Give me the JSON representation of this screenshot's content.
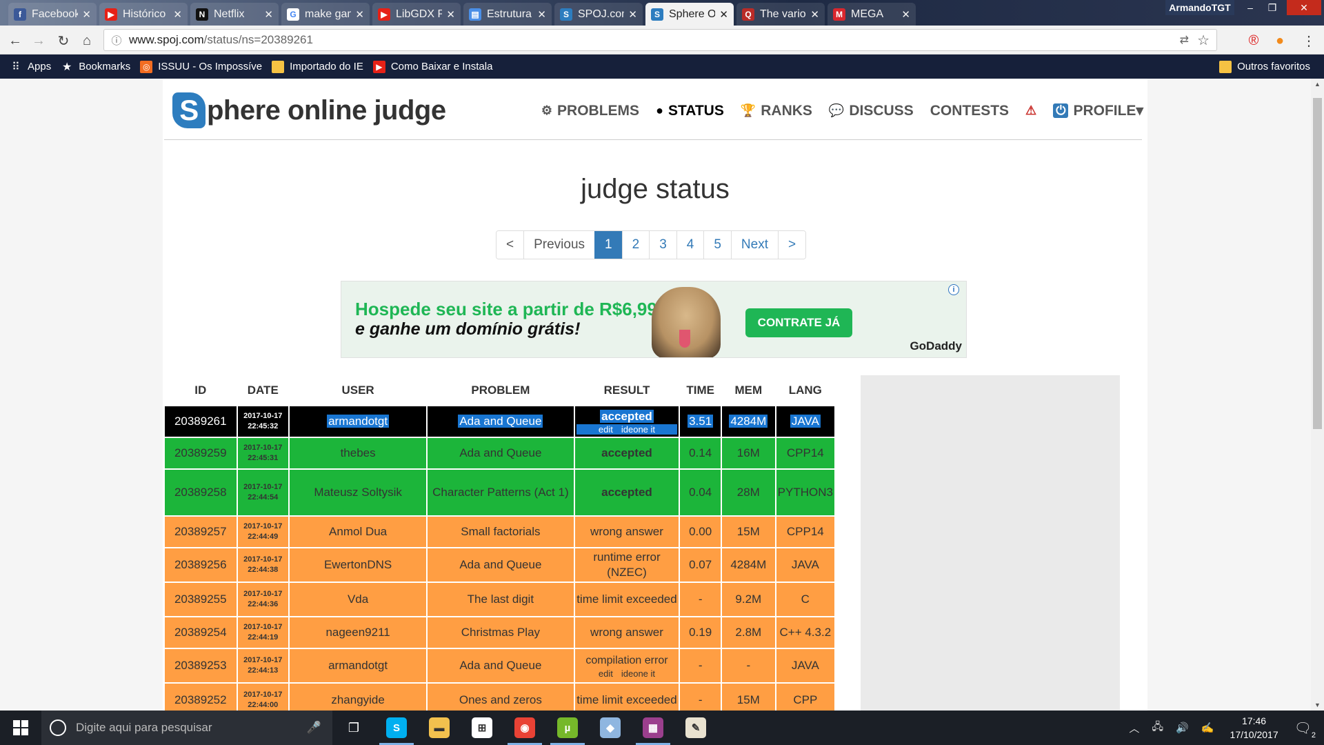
{
  "browser": {
    "tabs": [
      {
        "title": "Facebook",
        "icon": "facebook-icon",
        "color": "#3b5998",
        "glyph": "f"
      },
      {
        "title": "Histórico - Yo",
        "icon": "youtube-icon",
        "color": "#e62117",
        "glyph": "▶"
      },
      {
        "title": "Netflix",
        "icon": "netflix-icon",
        "color": "#111111",
        "glyph": "N"
      },
      {
        "title": "make game",
        "icon": "google-icon",
        "color": "#ffffff",
        "glyph": "G"
      },
      {
        "title": "LibGDX Part",
        "icon": "youtube-icon",
        "color": "#e62117",
        "glyph": "▶"
      },
      {
        "title": "Estrutura de",
        "icon": "document-icon",
        "color": "#4a8fe7",
        "glyph": "▤"
      },
      {
        "title": "SPOJ.com -",
        "icon": "spoj-icon",
        "color": "#2d7dbf",
        "glyph": "S"
      },
      {
        "title": "Sphere Onlin",
        "icon": "spoj-icon",
        "color": "#2d7dbf",
        "glyph": "S"
      },
      {
        "title": "The various",
        "icon": "quora-icon",
        "color": "#b92b27",
        "glyph": "Q"
      },
      {
        "title": "MEGA",
        "icon": "mega-icon",
        "color": "#d9272e",
        "glyph": "M"
      }
    ],
    "active_tab": 7,
    "profile_name": "ArmandoTGT",
    "url_host": "www.spoj.com",
    "url_path": "/status/ns=20389261",
    "bookmarks": [
      {
        "label": "Apps",
        "icon": "apps-grid-icon"
      },
      {
        "label": "Bookmarks",
        "icon": "star-icon"
      },
      {
        "label": "ISSUU - Os Impossíve",
        "icon": "issuu-icon"
      },
      {
        "label": "Importado do IE",
        "icon": "folder-icon"
      },
      {
        "label": "Como Baixar e Instala",
        "icon": "youtube-icon"
      }
    ],
    "other_bookmarks": "Outros favoritos"
  },
  "site": {
    "logo_letter": "S",
    "logo_text": "phere online judge",
    "nav": [
      {
        "label": "PROBLEMS",
        "icon": "puzzle-icon",
        "glyph": "⚙",
        "active": false
      },
      {
        "label": "STATUS",
        "icon": "circle-icon",
        "glyph": "●",
        "active": true
      },
      {
        "label": "RANKS",
        "icon": "trophy-icon",
        "glyph": "🏆",
        "active": false
      },
      {
        "label": "DISCUSS",
        "icon": "chat-icon",
        "glyph": "💬",
        "active": false
      },
      {
        "label": "CONTESTS",
        "icon": "",
        "glyph": "",
        "active": false
      },
      {
        "label": "",
        "icon": "warning-icon",
        "glyph": "⚠",
        "active": false
      },
      {
        "label": "PROFILE",
        "icon": "power-icon",
        "glyph": "⏻",
        "active": false
      }
    ]
  },
  "title": "judge status",
  "pagination": [
    "<",
    "Previous",
    "1",
    "2",
    "3",
    "4",
    "5",
    "Next",
    ">"
  ],
  "pagination_active": "1",
  "ad": {
    "line1": "Hospede seu site a partir de R$6,99",
    "line2": "e ganhe um domínio grátis!",
    "cta": "CONTRATE JÁ",
    "brand": "GoDaddy",
    "info": "i"
  },
  "table": {
    "columns": [
      "ID",
      "DATE",
      "USER",
      "PROBLEM",
      "RESULT",
      "TIME",
      "MEM",
      "LANG"
    ],
    "rows": [
      {
        "id": "20389261",
        "date1": "2017-10-17",
        "date2": "22:45:32",
        "user": "armandotgt",
        "problem": "Ada and Queue",
        "result": "accepted",
        "links": [
          "edit",
          "ideone it"
        ],
        "time": "3.51",
        "mem": "4284M",
        "lang": "JAVA",
        "type": "cur"
      },
      {
        "id": "20389259",
        "date1": "2017-10-17",
        "date2": "22:45:31",
        "user": "thebes",
        "problem": "Ada and Queue",
        "result": "accepted",
        "links": [],
        "time": "0.14",
        "mem": "16M",
        "lang": "CPP14",
        "type": "acc"
      },
      {
        "id": "20389258",
        "date1": "2017-10-17",
        "date2": "22:44:54",
        "user": "Mateusz Soltysik",
        "problem": "Character Patterns (Act 1)",
        "result": "accepted",
        "links": [],
        "time": "0.04",
        "mem": "28M",
        "lang": "PYTHON3",
        "type": "acc"
      },
      {
        "id": "20389257",
        "date1": "2017-10-17",
        "date2": "22:44:49",
        "user": "Anmol Dua",
        "problem": "Small factorials",
        "result": "wrong answer",
        "links": [],
        "time": "0.00",
        "mem": "15M",
        "lang": "CPP14",
        "type": "err"
      },
      {
        "id": "20389256",
        "date1": "2017-10-17",
        "date2": "22:44:38",
        "user": "EwertonDNS",
        "problem": "Ada and Queue",
        "result": "runtime error (NZEC)",
        "links": [],
        "time": "0.07",
        "mem": "4284M",
        "lang": "JAVA",
        "type": "err"
      },
      {
        "id": "20389255",
        "date1": "2017-10-17",
        "date2": "22:44:36",
        "user": "Vda",
        "problem": "The last digit",
        "result": "time limit exceeded",
        "links": [],
        "time": "-",
        "mem": "9.2M",
        "lang": "C",
        "type": "err"
      },
      {
        "id": "20389254",
        "date1": "2017-10-17",
        "date2": "22:44:19",
        "user": "nageen9211",
        "problem": "Christmas Play",
        "result": "wrong answer",
        "links": [],
        "time": "0.19",
        "mem": "2.8M",
        "lang": "C++ 4.3.2",
        "type": "err"
      },
      {
        "id": "20389253",
        "date1": "2017-10-17",
        "date2": "22:44:13",
        "user": "armandotgt",
        "problem": "Ada and Queue",
        "result": "compilation error",
        "links": [
          "edit",
          "ideone it"
        ],
        "time": "-",
        "mem": "-",
        "lang": "JAVA",
        "type": "err"
      },
      {
        "id": "20389252",
        "date1": "2017-10-17",
        "date2": "22:44:00",
        "user": "zhangyide",
        "problem": "Ones and zeros",
        "result": "time limit exceeded",
        "links": [],
        "time": "-",
        "mem": "15M",
        "lang": "CPP",
        "type": "err"
      }
    ]
  },
  "taskbar": {
    "search_placeholder": "Digite aqui para pesquisar",
    "apps": [
      {
        "icon": "skype-icon",
        "color": "#00aff0",
        "glyph": "S",
        "open": true
      },
      {
        "icon": "file-explorer-icon",
        "color": "#f2c14e",
        "glyph": "▬",
        "open": false
      },
      {
        "icon": "store-icon",
        "color": "#ffffff",
        "glyph": "⊞",
        "open": false
      },
      {
        "icon": "chrome-icon",
        "color": "#e94235",
        "glyph": "◉",
        "open": true
      },
      {
        "icon": "utorrent-icon",
        "color": "#76b82a",
        "glyph": "µ",
        "open": true
      },
      {
        "icon": "virtualbox-icon",
        "color": "#8fb6e0",
        "glyph": "◆",
        "open": false
      },
      {
        "icon": "winrar-icon",
        "color": "#9b3f8d",
        "glyph": "▦",
        "open": true
      },
      {
        "icon": "paint-icon",
        "color": "#e9e2d0",
        "glyph": "✎",
        "open": false
      }
    ],
    "time": "17:46",
    "date": "17/10/2017",
    "notification_count": "2"
  },
  "colors": {
    "accent": "#337ab7",
    "accepted": "#1cb53a",
    "error": "#ff9e43",
    "current": "#000000",
    "highlight": "#1976d2"
  }
}
